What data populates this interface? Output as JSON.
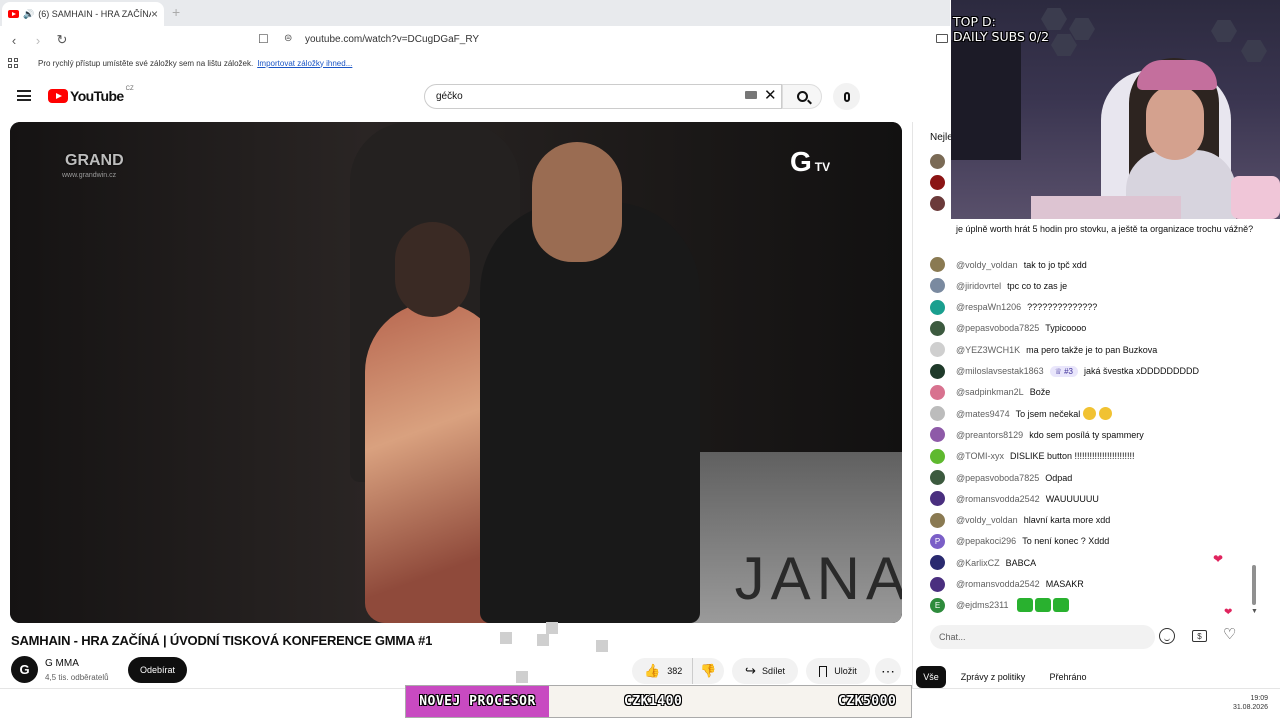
{
  "browser": {
    "tab_title": "(6) SAMHAIN - HRA ZAČÍNÁ",
    "url": "youtube.com/watch?v=DCugDGaF_RY",
    "bookmarks_prompt": "Pro rychlý přístup umístěte své záložky sem na lištu záložek.",
    "bookmarks_import_link": "Importovat záložky ihned..."
  },
  "youtube": {
    "logo_text": "YouTube",
    "country_code": "CZ",
    "search_query": "géčko"
  },
  "video": {
    "overlay_logo": "GRAND",
    "overlay_logo_sub": "www.grandwin.cz",
    "channel_watermark": "G",
    "channel_watermark_suffix": "TV",
    "background_text": "JANA",
    "title": "SAMHAIN - HRA ZAČÍNÁ | ÚVODNÍ TISKOVÁ KONFERENCE GMMA #1",
    "channel_name": "G MMA",
    "channel_avatar_letter": "G",
    "subscribers": "4,5 tis. odběratelů",
    "subscribe_label": "Odebírat",
    "likes": "382",
    "share_label": "Sdílet",
    "save_label": "Uložit"
  },
  "chat": {
    "header": "Nejle",
    "wrapped_message": "je úplně worth hrát 5 hodin pro stovku, a ještě ta organizace trochu vážně?",
    "messages": [
      {
        "author": "@voldy_voldan",
        "text": "tak to jo tpč xdd",
        "avatar_color": "#8a7a52"
      },
      {
        "author": "@jiridovrtel",
        "text": "tpc co to zas je",
        "avatar_color": "#7a8aa0"
      },
      {
        "author": "@respaWn1206",
        "text": "??????????????",
        "avatar_color": "#1a9f8f"
      },
      {
        "author": "@pepasvoboda7825",
        "text": "Typicoooo",
        "avatar_color": "#3c5a3f"
      },
      {
        "author": "@YEZ3WCH1K",
        "text": "ma pero takže je to pan Buzkova",
        "avatar_color": "#cfcfcf"
      },
      {
        "author": "@miloslavsestak1863",
        "badge": "#3",
        "text": "jaká švestka xDDDDDDDDD",
        "avatar_color": "#1f3a2a"
      },
      {
        "author": "@sadpinkman2L",
        "text": "Bože",
        "avatar_color": "#d8728f"
      },
      {
        "author": "@mates9474",
        "text": "To jsem nečekal",
        "avatar_color": "#bcbcbc"
      },
      {
        "author": "@preantors8129",
        "text": "kdo sem posílá ty spammery",
        "avatar_color": "#8e5aa8"
      },
      {
        "author": "@TOMI-xyx",
        "text": "DISLIKE button !!!!!!!!!!!!!!!!!!!!!!!!",
        "avatar_color": "#5fb92f"
      },
      {
        "author": "@pepasvoboda7825",
        "text": "Odpad",
        "avatar_color": "#3c5a3f"
      },
      {
        "author": "@romansvodda2542",
        "text": "WAUUUUUU",
        "avatar_color": "#4a2f7f"
      },
      {
        "author": "@voldy_voldan",
        "text": "hlavní karta more xdd",
        "avatar_color": "#8a7a52"
      },
      {
        "author": "@pepakoci296",
        "avatar_letter": "P",
        "text": "To není konec ? Xddd",
        "avatar_color": "#7b5fc7"
      },
      {
        "author": "@KarlixCZ",
        "text": "BABCA",
        "avatar_color": "#2a2a6f"
      },
      {
        "author": "@romansvodda2542",
        "text": "MASAKR",
        "avatar_color": "#4a2f7f"
      },
      {
        "author": "@ejdms2311",
        "avatar_letter": "E",
        "text": "",
        "avatar_color": "#2e8b3c"
      }
    ],
    "input_placeholder": "Chat...",
    "filters": [
      "Vše",
      "Zprávy z politiky",
      "Přehráno"
    ]
  },
  "stream_overlay": {
    "goal_line1": "TOP D:",
    "goal_line2": "DAILY SUBS 0/2",
    "ticker_label": "NOVEJ PROCESOR",
    "price1": "CZK1400",
    "price2": "CZK5000"
  },
  "clock": {
    "time": "19:09",
    "date": "31.08.2026"
  }
}
